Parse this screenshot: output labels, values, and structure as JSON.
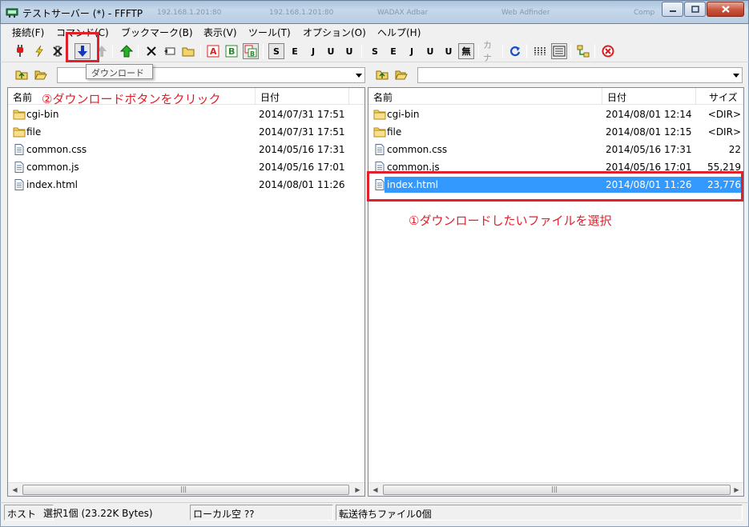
{
  "window": {
    "title": "テストサーバー (*) - FFFTP",
    "ghost_tabs": [
      "192.168.1.201:80",
      "192.168.1.201:80",
      "WADAX Adbar",
      "Web Adfinder",
      "Comp"
    ]
  },
  "menu": [
    "接続(F)",
    "コマンド(C)",
    "ブックマーク(B)",
    "表示(V)",
    "ツール(T)",
    "オプション(O)",
    "ヘルプ(H)"
  ],
  "toolbar": {
    "tooltip": "ダウンロード",
    "s_labels": [
      "S",
      "E",
      "J",
      "U",
      "U",
      "無",
      "カナ"
    ]
  },
  "annotations": {
    "step1": "①ダウンロードしたいファイルを選択",
    "step2": "②ダウンロードボタンをクリック"
  },
  "local": {
    "path": "",
    "headers": {
      "name": "名前",
      "date": "日付"
    },
    "files": [
      {
        "name": "cgi-bin",
        "date": "2014/07/31 17:51",
        "type": "folder"
      },
      {
        "name": "file",
        "date": "2014/07/31 17:51",
        "type": "folder"
      },
      {
        "name": "common.css",
        "date": "2014/05/16 17:31",
        "type": "file"
      },
      {
        "name": "common.js",
        "date": "2014/05/16 17:01",
        "type": "file"
      },
      {
        "name": "index.html",
        "date": "2014/08/01 11:26",
        "type": "file"
      }
    ]
  },
  "remote": {
    "path": "",
    "headers": {
      "name": "名前",
      "date": "日付",
      "size": "サイズ"
    },
    "files": [
      {
        "name": "cgi-bin",
        "date": "2014/08/01 12:14",
        "size": "<DIR>",
        "type": "folder"
      },
      {
        "name": "file",
        "date": "2014/08/01 12:15",
        "size": "<DIR>",
        "type": "folder"
      },
      {
        "name": "common.css",
        "date": "2014/05/16 17:31",
        "size": "22",
        "type": "file"
      },
      {
        "name": "common.js",
        "date": "2014/05/16 17:01",
        "size": "55,219",
        "type": "file"
      },
      {
        "name": "index.html",
        "date": "2014/08/01 11:26",
        "size": "23,776",
        "type": "file",
        "selected": true
      }
    ]
  },
  "status": {
    "host": "ホスト",
    "selection": "選択1個 (23.22K Bytes)",
    "local_free": "ローカル空 ??",
    "queue": "転送待ちファイル0個"
  },
  "colors": {
    "accent_red": "#e0202a",
    "selection_blue": "#3399ff"
  }
}
